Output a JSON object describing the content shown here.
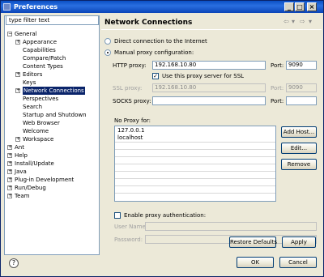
{
  "window": {
    "title": "Preferences",
    "min_label": "_",
    "max_label": "□",
    "close_label": "×"
  },
  "filter": {
    "placeholder": "type filter text"
  },
  "tree": [
    {
      "label": "General",
      "indent": 0,
      "twisty": "−",
      "selected": false
    },
    {
      "label": "Appearance",
      "indent": 1,
      "twisty": "+",
      "selected": false
    },
    {
      "label": "Capabilities",
      "indent": 1,
      "twisty": "",
      "selected": false
    },
    {
      "label": "Compare/Patch",
      "indent": 1,
      "twisty": "",
      "selected": false
    },
    {
      "label": "Content Types",
      "indent": 1,
      "twisty": "",
      "selected": false
    },
    {
      "label": "Editors",
      "indent": 1,
      "twisty": "+",
      "selected": false
    },
    {
      "label": "Keys",
      "indent": 1,
      "twisty": "",
      "selected": false
    },
    {
      "label": "Network Connections",
      "indent": 1,
      "twisty": "+",
      "selected": true
    },
    {
      "label": "Perspectives",
      "indent": 1,
      "twisty": "",
      "selected": false
    },
    {
      "label": "Search",
      "indent": 1,
      "twisty": "",
      "selected": false
    },
    {
      "label": "Startup and Shutdown",
      "indent": 1,
      "twisty": "",
      "selected": false
    },
    {
      "label": "Web Browser",
      "indent": 1,
      "twisty": "",
      "selected": false
    },
    {
      "label": "Welcome",
      "indent": 1,
      "twisty": "",
      "selected": false
    },
    {
      "label": "Workspace",
      "indent": 1,
      "twisty": "+",
      "selected": false
    },
    {
      "label": "Ant",
      "indent": 0,
      "twisty": "+",
      "selected": false
    },
    {
      "label": "Help",
      "indent": 0,
      "twisty": "+",
      "selected": false
    },
    {
      "label": "Install/Update",
      "indent": 0,
      "twisty": "+",
      "selected": false
    },
    {
      "label": "Java",
      "indent": 0,
      "twisty": "+",
      "selected": false
    },
    {
      "label": "Plug-in Development",
      "indent": 0,
      "twisty": "+",
      "selected": false
    },
    {
      "label": "Run/Debug",
      "indent": 0,
      "twisty": "+",
      "selected": false
    },
    {
      "label": "Team",
      "indent": 0,
      "twisty": "+",
      "selected": false
    }
  ],
  "page": {
    "title": "Network Connections",
    "direct_label": "Direct connection to the Internet",
    "manual_label": "Manual proxy configuration:",
    "http_label": "HTTP proxy:",
    "http_value": "192.168.10.80",
    "port_label": "Port:",
    "http_port": "9090",
    "use_ssl_label": "Use this proxy server for SSL",
    "ssl_label": "SSL proxy:",
    "ssl_value": "192.168.10.80",
    "ssl_port": "9090",
    "socks_label": "SOCKS proxy:",
    "socks_value": "",
    "socks_port": "",
    "noproxy_label": "No Proxy for:",
    "noproxy_items": [
      "127.0.0.1",
      "localhost"
    ],
    "add_host": "Add Host...",
    "edit": "Edit...",
    "remove": "Remove",
    "enable_auth_label": "Enable proxy authentication:",
    "username_label": "User Name:",
    "password_label": "Password:",
    "restore_defaults": "Restore Defaults",
    "apply": "Apply",
    "back_arrow": "⇦",
    "fwd_arrow": "⇨",
    "dropdown_arrow": "▾"
  },
  "footer": {
    "ok": "OK",
    "cancel": "Cancel",
    "help_icon": "?"
  }
}
